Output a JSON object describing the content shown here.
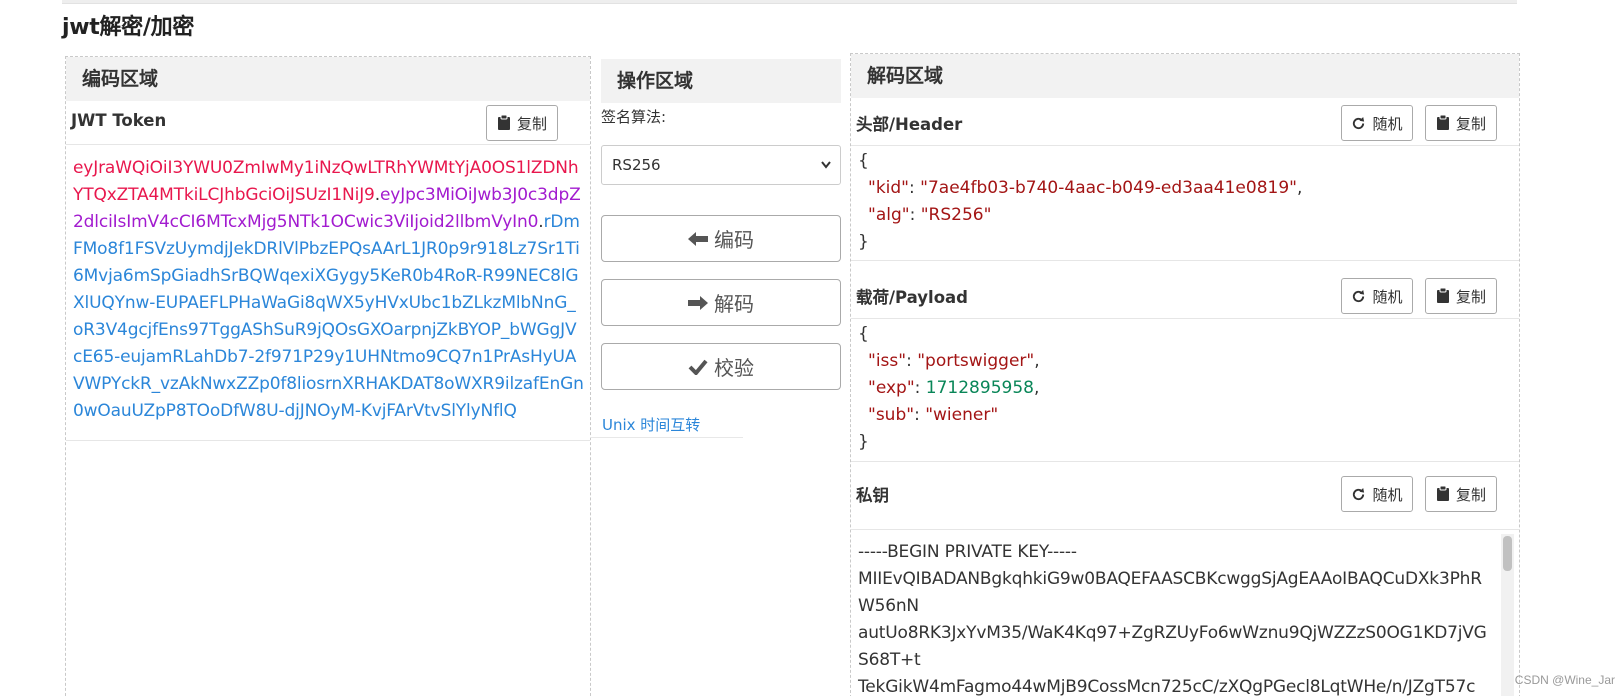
{
  "page": {
    "title": "jwt解密/加密"
  },
  "encode_panel": {
    "heading": "编码区域",
    "token_label": "JWT Token",
    "copy_label": "复制",
    "token": {
      "header": "eyJraWQiOiI3YWU0ZmIwMy1iNzQwLTRhYWMtYjA0OS1lZDNhYTQxZTA4MTkiLCJhbGciOiJSUzI1NiJ9",
      "dot1": ".",
      "payload": "eyJpc3MiOiJwb3J0c3dpZ2dlciIsImV4cCI6MTcxMjg5NTk1OCwic3ViIjoid2llbmVyIn0",
      "dot2": ".",
      "signature": "rDmFMo8f1FSVzUymdjJekDRlVlPbzEPQsAArL1JR0p9r918Lz7Sr1Ti6Mvja6mSpGiadhSrBQWqexiXGygy5KeR0b4RoR-R99NEC8lGXlUQYnw-EUPAEFLPHaWaGi8qWX5yHVxUbc1bZLkzMlbNnG_oR3V4gcjfEns97TggAShSuR9jQOsGXOarpnjZkBYOP_bWGgJVcE65-eujamRLahDb7-2f971P29y1UHNtmo9CQ7n1PrAsHyUAVWPYckR_vzAkNwxZZp0f8liosrnXRHAKDAT8oWXR9ilzafEnGn0wOauUZpP8TOoDfW8U-djJNOyM-KvjFArVtvSlYlyNflQ"
    }
  },
  "operation_panel": {
    "heading": "操作区域",
    "algo_label": "签名算法:",
    "algo_selected": "RS256",
    "encode_label": "编码",
    "decode_label": "解码",
    "verify_label": "校验",
    "unix_link": "Unix 时间互转"
  },
  "decode_panel": {
    "heading": "解码区域",
    "header_title": "头部/Header",
    "payload_title": "载荷/Payload",
    "private_key_title": "私钥",
    "random_label": "随机",
    "copy_label": "复制",
    "header_json": {
      "open": "{",
      "close": "}",
      "kid_key": "\"kid\"",
      "kid_value": "\"7ae4fb03-b740-4aac-b049-ed3aa41e0819\"",
      "alg_key": "\"alg\"",
      "alg_value": "\"RS256\""
    },
    "payload_json": {
      "open": "{",
      "close": "}",
      "iss_key": "\"iss\"",
      "iss_value": "\"portswigger\"",
      "exp_key": "\"exp\"",
      "exp_value": "1712895958",
      "sub_key": "\"sub\"",
      "sub_value": "\"wiener\""
    },
    "private_key_lines": [
      "-----BEGIN PRIVATE KEY-----",
      "MIIEvQIBADANBgkqhkiG9w0BAQEFAASCBKcwggSjAgEAAoIBAQCuDXk3PhRW56nN",
      "autUo8RK3JxYvM35/WaK4Kq97+ZgRZUyFo6wWznu9QjWZZzS0OG1KD7jVGS68T+t",
      "TekGikW4mFagmo44wMjB9CossMcn725cC/zXQgPGecl8LqtWHe/n/JZgT57c"
    ]
  },
  "watermark": "CSDN @Wine_Jar",
  "colors": {
    "token_header": "#e8174d",
    "token_payload": "#a21bcf",
    "token_signature": "#2b86d9",
    "json_string": "#a31515",
    "json_number": "#098658",
    "link": "#2b86d9"
  }
}
